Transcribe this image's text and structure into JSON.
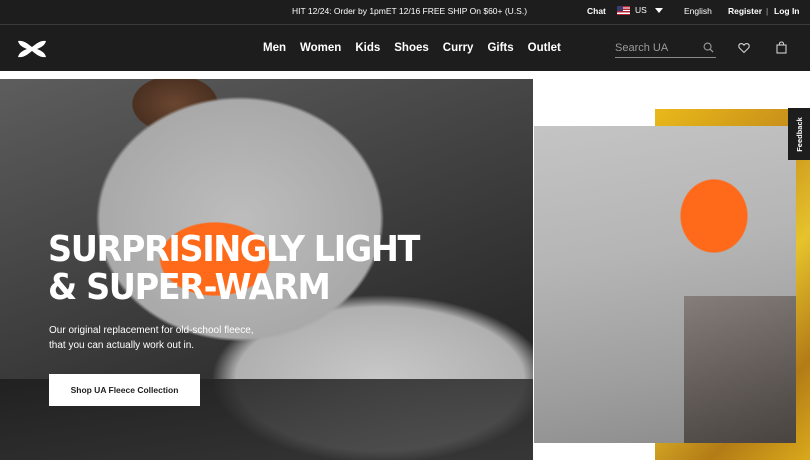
{
  "promo": {
    "text": "HIT 12/24: Order by 1pmET 12/16 FREE SHIP On $60+ (U.S.)"
  },
  "utility": {
    "chat": "Chat",
    "country": "US",
    "language": "English",
    "register": "Register",
    "separator": "|",
    "login": "Log In"
  },
  "nav": {
    "links": [
      "Men",
      "Women",
      "Kids",
      "Shoes",
      "Curry",
      "Gifts",
      "Outlet"
    ],
    "search_placeholder": "Search UA"
  },
  "hero": {
    "headline_line1": "SURPRISINGLY LIGHT",
    "headline_line2": "& SUPER-WARM",
    "subtext_line1": "Our original replacement for old-school fleece,",
    "subtext_line2": "that you can actually work out in.",
    "cta": "Shop UA Fleece Collection"
  },
  "feedback": {
    "label": "Feedback"
  },
  "colors": {
    "header_bg": "#1d1d1d",
    "accent_orange": "#ff6a1a",
    "cta_bg": "#ffffff"
  }
}
